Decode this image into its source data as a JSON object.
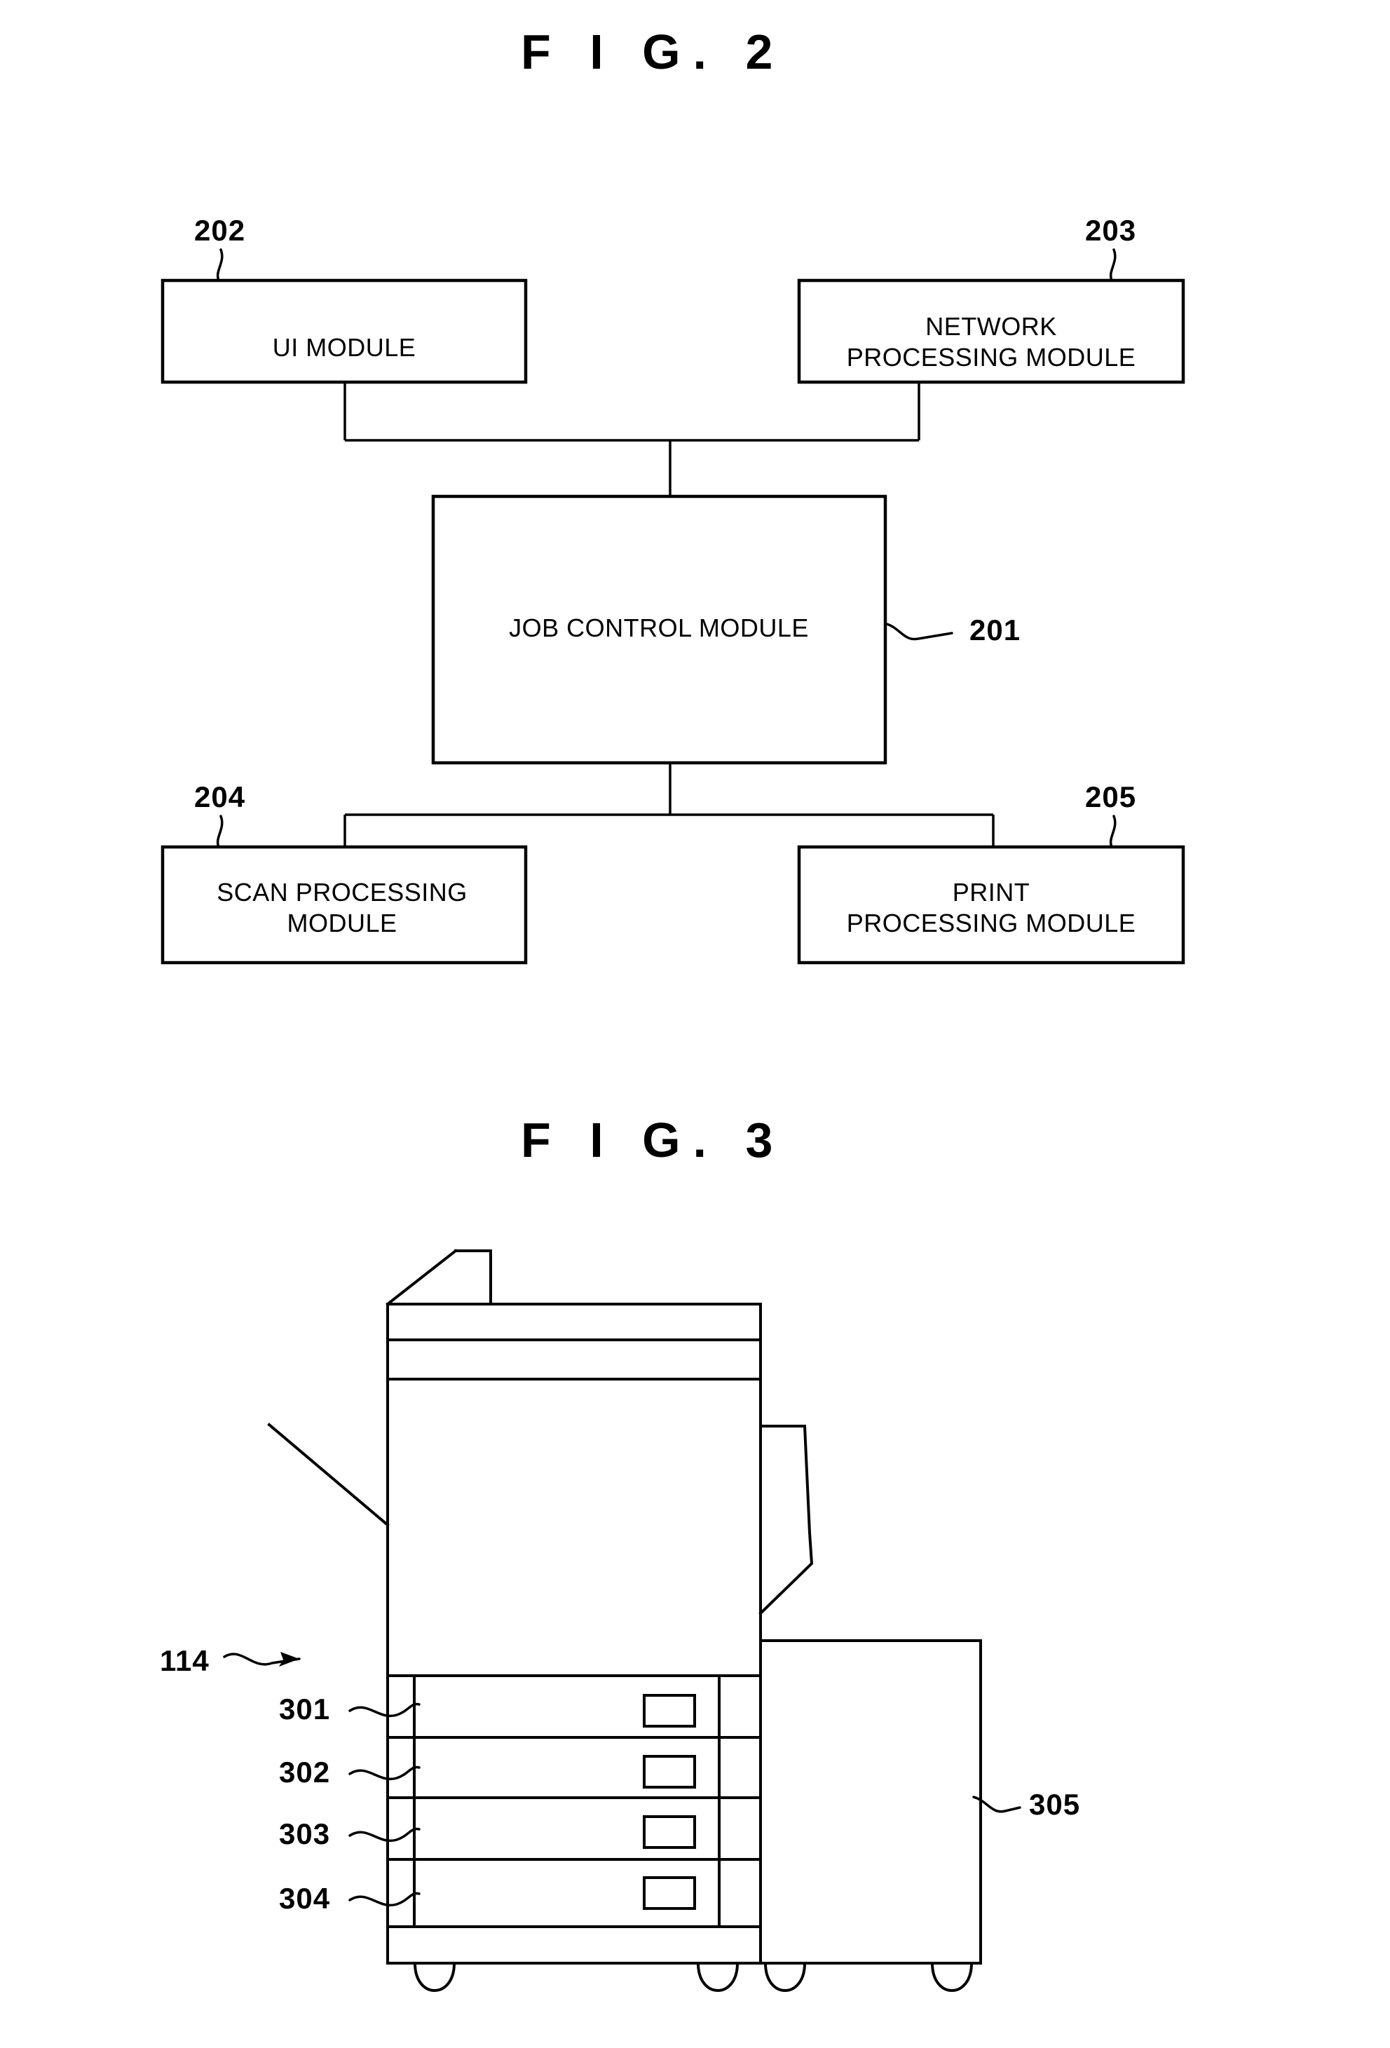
{
  "page": {
    "background_color": "#ffffff",
    "ink_color": "#000000"
  },
  "figures": [
    {
      "id": "figure-2",
      "title": "F I G.  2",
      "type": "block-diagram",
      "blocks": [
        {
          "ref": "202",
          "label_lines": [
            "UI MODULE"
          ]
        },
        {
          "ref": "203",
          "label_lines": [
            "NETWORK",
            "PROCESSING MODULE"
          ]
        },
        {
          "ref": "201",
          "label_lines": [
            "JOB CONTROL MODULE"
          ]
        },
        {
          "ref": "204",
          "label_lines": [
            "SCAN PROCESSING",
            "MODULE"
          ]
        },
        {
          "ref": "205",
          "label_lines": [
            "PRINT",
            "PROCESSING MODULE"
          ]
        }
      ],
      "connections": [
        {
          "from": "202",
          "to": "201"
        },
        {
          "from": "203",
          "to": "201"
        },
        {
          "from": "201",
          "to": "204"
        },
        {
          "from": "201",
          "to": "205"
        }
      ]
    },
    {
      "id": "figure-3",
      "title": "F I G.  3",
      "type": "apparatus-illustration",
      "device_ref": "114",
      "callouts": [
        {
          "ref": "301",
          "target": "paper-cassette-1"
        },
        {
          "ref": "302",
          "target": "paper-cassette-2"
        },
        {
          "ref": "303",
          "target": "paper-cassette-3"
        },
        {
          "ref": "304",
          "target": "paper-cassette-4"
        },
        {
          "ref": "305",
          "target": "finisher-unit"
        }
      ]
    }
  ],
  "fig2": {
    "title": "F I G.  2",
    "ui_module": {
      "ref": "202",
      "line1": "UI MODULE"
    },
    "network_module": {
      "ref": "203",
      "line1": "NETWORK",
      "line2": "PROCESSING MODULE"
    },
    "job_control_module": {
      "ref": "201",
      "line1": "JOB CONTROL MODULE"
    },
    "scan_module": {
      "ref": "204",
      "line1": "SCAN PROCESSING",
      "line2": "MODULE"
    },
    "print_module": {
      "ref": "205",
      "line1": "PRINT",
      "line2": "PROCESSING MODULE"
    }
  },
  "fig3": {
    "title": "F I G.  3",
    "device": {
      "ref": "114"
    },
    "cassette1": {
      "ref": "301"
    },
    "cassette2": {
      "ref": "302"
    },
    "cassette3": {
      "ref": "303"
    },
    "cassette4": {
      "ref": "304"
    },
    "finisher": {
      "ref": "305"
    }
  }
}
